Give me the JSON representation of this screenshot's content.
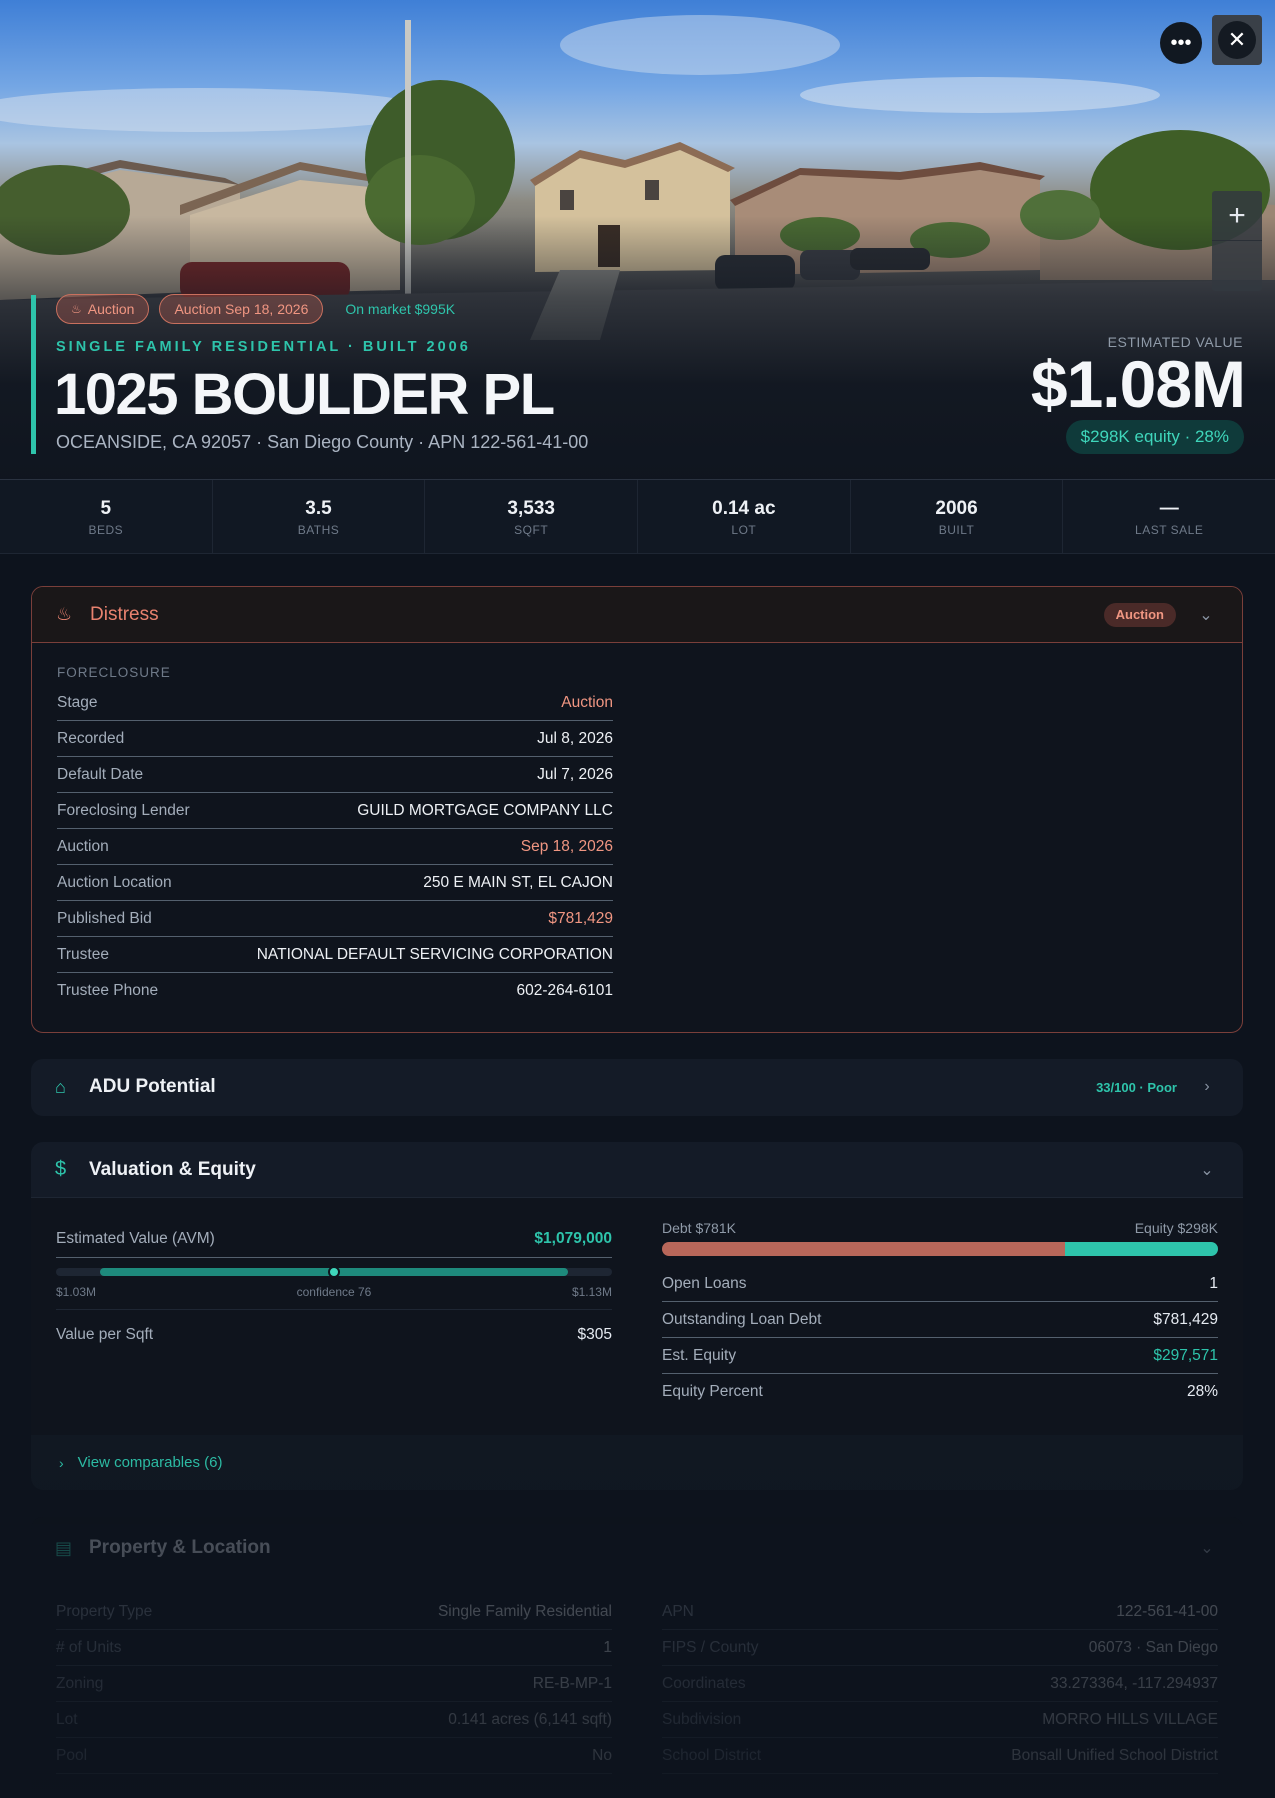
{
  "hero": {
    "badges": [
      {
        "icon": "flame-icon",
        "label": "Auction"
      },
      {
        "label": "Auction Sep 18, 2026"
      }
    ],
    "on_market": "On market $995K",
    "type_line": "SINGLE FAMILY RESIDENTIAL · BUILT 2006",
    "address": "1025 BOULDER PL",
    "subline": "OCEANSIDE, CA 92057 · San Diego County · APN 122-561-41-00",
    "estimated_label": "ESTIMATED VALUE",
    "estimated_value": "$1.08M",
    "equity_pill": "$298K equity · 28%",
    "more_icon": "more-horizontal-icon",
    "close_icon": "close-icon",
    "zoom_in": "+"
  },
  "stats": [
    {
      "value": "5",
      "label": "BEDS"
    },
    {
      "value": "3.5",
      "label": "BATHS"
    },
    {
      "value": "3,533",
      "label": "SQFT"
    },
    {
      "value": "0.14 ac",
      "label": "LOT"
    },
    {
      "value": "2006",
      "label": "BUILT"
    },
    {
      "value": "—",
      "label": "LAST SALE"
    }
  ],
  "distress": {
    "title": "Distress",
    "icon": "flame-icon",
    "badge": "Auction",
    "section_label": "FORECLOSURE",
    "rows": [
      {
        "key": "Stage",
        "value": "Auction",
        "accent": "red"
      },
      {
        "key": "Recorded",
        "value": "Jul 8, 2026"
      },
      {
        "key": "Default Date",
        "value": "Jul 7, 2026"
      },
      {
        "key": "Foreclosing Lender",
        "value": "GUILD MORTGAGE COMPANY LLC"
      },
      {
        "key": "Auction",
        "value": "Sep 18, 2026",
        "accent": "red"
      },
      {
        "key": "Auction Location",
        "value": "250 E MAIN ST, EL CAJON"
      },
      {
        "key": "Published Bid",
        "value": "$781,429",
        "accent": "red"
      },
      {
        "key": "Trustee",
        "value": "NATIONAL DEFAULT SERVICING CORPORATION"
      },
      {
        "key": "Trustee Phone",
        "value": "602-264-6101"
      }
    ]
  },
  "adu": {
    "title": "ADU Potential",
    "icon": "home-icon",
    "score": "33/100 · Poor"
  },
  "valuation": {
    "title": "Valuation & Equity",
    "icon": "dollar-icon",
    "avm_label": "Estimated Value (AVM)",
    "avm_value": "$1,079,000",
    "range_low": "$1.03M",
    "range_high": "$1.13M",
    "confidence": "confidence 76",
    "range_fill_start": 0.08,
    "range_fill_end": 0.92,
    "marker_position": 0.5,
    "value_per_sqft_label": "Value per Sqft",
    "value_per_sqft": "$305",
    "debt_label": "Debt $781K",
    "equity_label": "Equity $298K",
    "debt_fraction": 0.724,
    "rows": [
      {
        "key": "Open Loans",
        "value": "1"
      },
      {
        "key": "Outstanding Loan Debt",
        "value": "$781,429"
      },
      {
        "key": "Est. Equity",
        "value": "$297,571",
        "accent": "green"
      },
      {
        "key": "Equity Percent",
        "value": "28%"
      }
    ],
    "comparables": "View comparables (6)"
  },
  "property": {
    "title": "Property & Location",
    "icon": "building-icon",
    "left": [
      {
        "key": "Property Type",
        "value": "Single Family Residential"
      },
      {
        "key": "# of Units",
        "value": "1"
      },
      {
        "key": "Zoning",
        "value": "RE-B-MP-1"
      },
      {
        "key": "Lot",
        "value": "0.141 acres (6,141 sqft)"
      },
      {
        "key": "Pool",
        "value": "No"
      }
    ],
    "right": [
      {
        "key": "APN",
        "value": "122-561-41-00"
      },
      {
        "key": "FIPS / County",
        "value": "06073 · San Diego"
      },
      {
        "key": "Coordinates",
        "value": "33.273364, -117.294937"
      },
      {
        "key": "Subdivision",
        "value": "MORRO HILLS VILLAGE"
      },
      {
        "key": "School District",
        "value": "Bonsall Unified School District"
      }
    ]
  },
  "colors": {
    "accent": "#2ec4ab",
    "danger": "#f09682",
    "background": "#0d131d"
  }
}
